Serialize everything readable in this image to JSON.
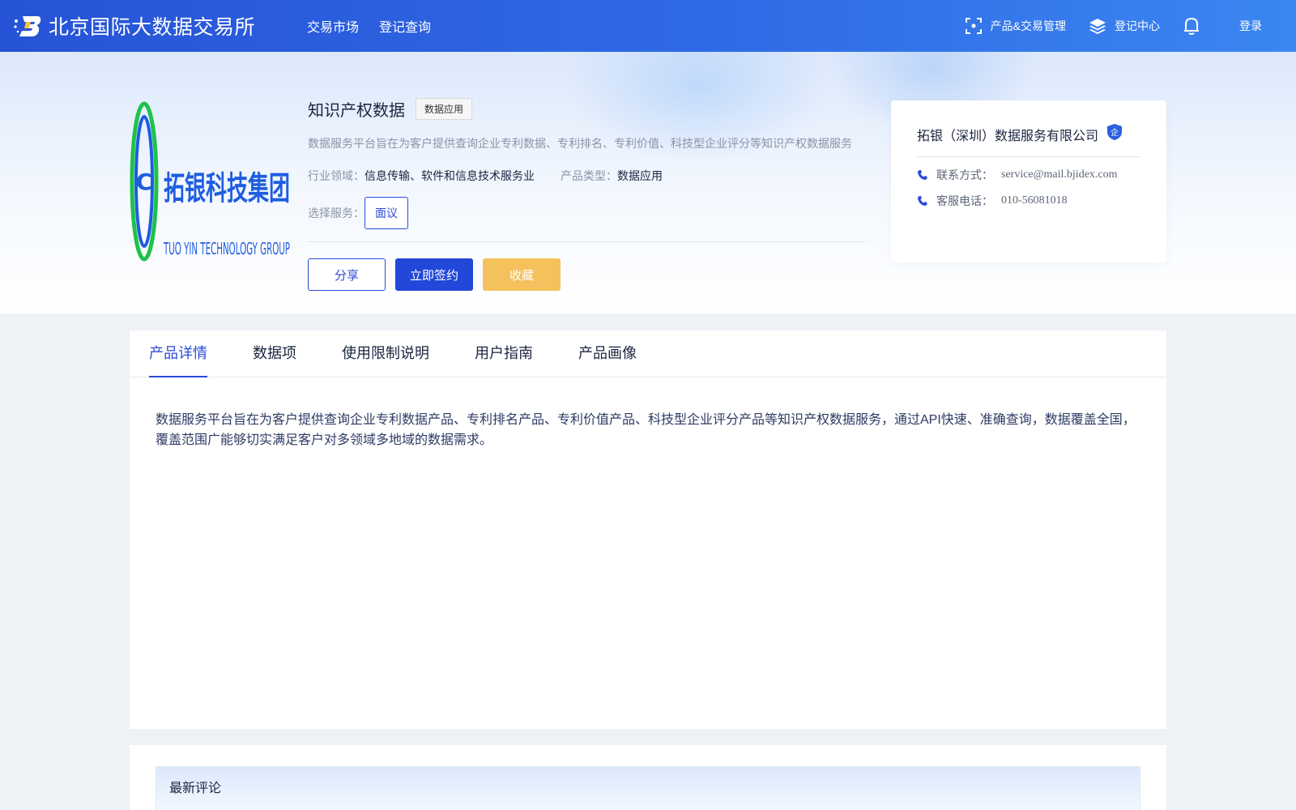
{
  "header": {
    "brand_title": "北京国际大数据交易所",
    "nav": [
      "交易市场",
      "登记查询"
    ],
    "right": {
      "product_mgmt": "产品&交易管理",
      "register_center": "登记中心",
      "login": "登录"
    }
  },
  "product": {
    "title": "知识产权数据",
    "tag": "数据应用",
    "description": "数据服务平台旨在为客户提供查询企业专利数据、专利排名、专利价值、科技型企业评分等知识产权数据服务",
    "industry_label": "行业领域：",
    "industry_value": "信息传输、软件和信息技术服务业",
    "type_label": "产品类型：",
    "type_value": "数据应用",
    "service_label": "选择服务：",
    "service_option": "面议",
    "actions": {
      "share": "分享",
      "sign": "立即签约",
      "favorite": "收藏"
    },
    "logo_text_cn": "拓银科技集团",
    "logo_text_en": "TUO YIN TECHNOLOGY GROUP"
  },
  "company": {
    "name": "拓银（深圳）数据服务有限公司",
    "badge": "企",
    "contact_label": "联系方式：",
    "contact_value": "service@mail.bjidex.com",
    "phone_label": "客服电话：",
    "phone_value": "010-56081018"
  },
  "tabs": [
    {
      "label": "产品详情",
      "active": true
    },
    {
      "label": "数据项",
      "active": false
    },
    {
      "label": "使用限制说明",
      "active": false
    },
    {
      "label": "用户指南",
      "active": false
    },
    {
      "label": "产品画像",
      "active": false
    }
  ],
  "detail_text": "数据服务平台旨在为客户提供查询企业专利数据产品、专利排名产品、专利价值产品、科技型企业评分产品等知识产权数据服务，通过API快速、准确查询，数据覆盖全国，覆盖范围广能够切实满足客户对多领域多地域的数据需求。",
  "comments": {
    "title": "最新评论"
  },
  "colors": {
    "primary": "#2148d8",
    "favorite": "#f5c15c",
    "header_start": "#2753d6",
    "header_end": "#3b86f1"
  }
}
